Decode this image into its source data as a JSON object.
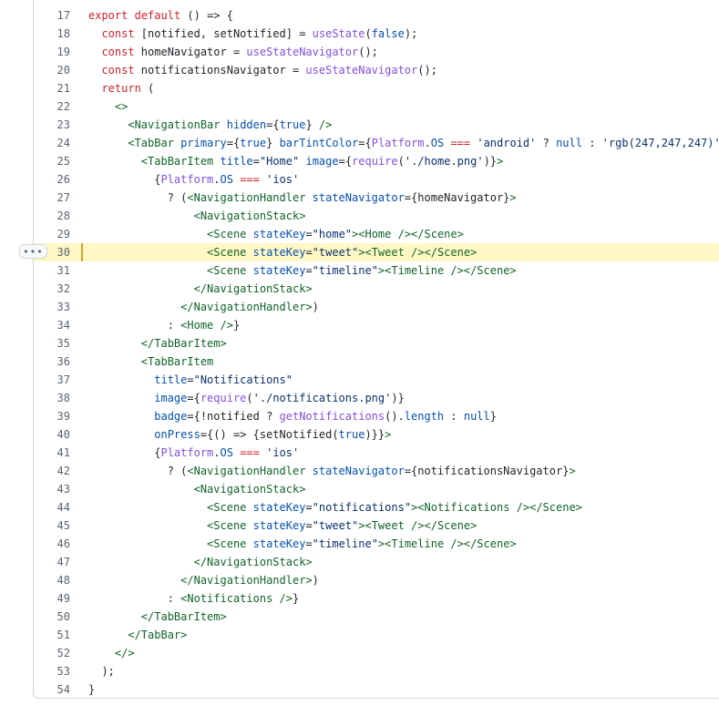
{
  "colors": {
    "kw": "#cf222e",
    "fn": "#8250df",
    "const": "#0550ae",
    "str": "#0a3069",
    "tag": "#116329",
    "plain": "#1f2328"
  },
  "expand_button": {
    "icon": "kebab-horizontal-icon",
    "glyph": "•••"
  },
  "highlighted_line": 30,
  "lines": [
    {
      "n": "17",
      "t": [
        [
          "kw",
          "export"
        ],
        [
          "p",
          " "
        ],
        [
          "kw",
          "default"
        ],
        [
          "p",
          " () => {"
        ]
      ]
    },
    {
      "n": "18",
      "t": [
        [
          "p",
          "  "
        ],
        [
          "kw",
          "const"
        ],
        [
          "p",
          " [notified, setNotified] = "
        ],
        [
          "fn",
          "useState"
        ],
        [
          "p",
          "("
        ],
        [
          "const",
          "false"
        ],
        [
          "p",
          ");"
        ]
      ]
    },
    {
      "n": "19",
      "t": [
        [
          "p",
          "  "
        ],
        [
          "kw",
          "const"
        ],
        [
          "p",
          " homeNavigator = "
        ],
        [
          "fn",
          "useStateNavigator"
        ],
        [
          "p",
          "();"
        ]
      ]
    },
    {
      "n": "20",
      "t": [
        [
          "p",
          "  "
        ],
        [
          "kw",
          "const"
        ],
        [
          "p",
          " notificationsNavigator = "
        ],
        [
          "fn",
          "useStateNavigator"
        ],
        [
          "p",
          "();"
        ]
      ]
    },
    {
      "n": "21",
      "t": [
        [
          "p",
          "  "
        ],
        [
          "kw",
          "return"
        ],
        [
          "p",
          " ("
        ]
      ]
    },
    {
      "n": "22",
      "t": [
        [
          "p",
          "    "
        ],
        [
          "tag",
          "<>"
        ]
      ]
    },
    {
      "n": "23",
      "t": [
        [
          "p",
          "      "
        ],
        [
          "tag",
          "<NavigationBar"
        ],
        [
          "p",
          " "
        ],
        [
          "const",
          "hidden"
        ],
        [
          "p",
          "={"
        ],
        [
          "const",
          "true"
        ],
        [
          "p",
          "} "
        ],
        [
          "tag",
          "/>"
        ]
      ]
    },
    {
      "n": "24",
      "t": [
        [
          "p",
          "      "
        ],
        [
          "tag",
          "<TabBar"
        ],
        [
          "p",
          " "
        ],
        [
          "const",
          "primary"
        ],
        [
          "p",
          "={"
        ],
        [
          "const",
          "true"
        ],
        [
          "p",
          "} "
        ],
        [
          "const",
          "barTintColor"
        ],
        [
          "p",
          "={"
        ],
        [
          "fn",
          "Platform"
        ],
        [
          "p",
          "."
        ],
        [
          "const",
          "OS"
        ],
        [
          "p",
          " "
        ],
        [
          "kw",
          "==="
        ],
        [
          "p",
          " "
        ],
        [
          "str",
          "'android'"
        ],
        [
          "p",
          " ? "
        ],
        [
          "const",
          "null"
        ],
        [
          "p",
          " : "
        ],
        [
          "str",
          "'rgb(247,247,247)'"
        ]
      ]
    },
    {
      "n": "25",
      "t": [
        [
          "p",
          "        "
        ],
        [
          "tag",
          "<TabBarItem"
        ],
        [
          "p",
          " "
        ],
        [
          "const",
          "title"
        ],
        [
          "p",
          "="
        ],
        [
          "str",
          "\"Home\""
        ],
        [
          "p",
          " "
        ],
        [
          "const",
          "image"
        ],
        [
          "p",
          "={"
        ],
        [
          "fn",
          "require"
        ],
        [
          "p",
          "("
        ],
        [
          "str",
          "'./home.png'"
        ],
        [
          "p",
          ")}"
        ],
        [
          "tag",
          ">"
        ]
      ]
    },
    {
      "n": "26",
      "t": [
        [
          "p",
          "          {"
        ],
        [
          "fn",
          "Platform"
        ],
        [
          "p",
          "."
        ],
        [
          "const",
          "OS"
        ],
        [
          "p",
          " "
        ],
        [
          "kw",
          "==="
        ],
        [
          "p",
          " "
        ],
        [
          "str",
          "'ios'"
        ]
      ]
    },
    {
      "n": "27",
      "t": [
        [
          "p",
          "            ? ("
        ],
        [
          "tag",
          "<NavigationHandler"
        ],
        [
          "p",
          " "
        ],
        [
          "const",
          "stateNavigator"
        ],
        [
          "p",
          "={homeNavigator}"
        ],
        [
          "tag",
          ">"
        ]
      ]
    },
    {
      "n": "28",
      "t": [
        [
          "p",
          "                "
        ],
        [
          "tag",
          "<NavigationStack>"
        ]
      ]
    },
    {
      "n": "29",
      "t": [
        [
          "p",
          "                  "
        ],
        [
          "tag",
          "<Scene"
        ],
        [
          "p",
          " "
        ],
        [
          "const",
          "stateKey"
        ],
        [
          "p",
          "="
        ],
        [
          "str",
          "\"home\""
        ],
        [
          "tag",
          "><Home /></Scene>"
        ]
      ]
    },
    {
      "n": "30",
      "t": [
        [
          "p",
          "                  "
        ],
        [
          "tag",
          "<Scene"
        ],
        [
          "p",
          " "
        ],
        [
          "const",
          "stateKey"
        ],
        [
          "p",
          "="
        ],
        [
          "str",
          "\"tweet\""
        ],
        [
          "tag",
          "><Tweet /></Scene>"
        ]
      ]
    },
    {
      "n": "31",
      "t": [
        [
          "p",
          "                  "
        ],
        [
          "tag",
          "<Scene"
        ],
        [
          "p",
          " "
        ],
        [
          "const",
          "stateKey"
        ],
        [
          "p",
          "="
        ],
        [
          "str",
          "\"timeline\""
        ],
        [
          "tag",
          "><Timeline /></Scene>"
        ]
      ]
    },
    {
      "n": "32",
      "t": [
        [
          "p",
          "                "
        ],
        [
          "tag",
          "</NavigationStack>"
        ]
      ]
    },
    {
      "n": "33",
      "t": [
        [
          "p",
          "              "
        ],
        [
          "tag",
          "</NavigationHandler>"
        ],
        [
          "p",
          ")"
        ]
      ]
    },
    {
      "n": "34",
      "t": [
        [
          "p",
          "            : "
        ],
        [
          "tag",
          "<Home />"
        ],
        [
          "p",
          "}"
        ]
      ]
    },
    {
      "n": "35",
      "t": [
        [
          "p",
          "        "
        ],
        [
          "tag",
          "</TabBarItem>"
        ]
      ]
    },
    {
      "n": "36",
      "t": [
        [
          "p",
          "        "
        ],
        [
          "tag",
          "<TabBarItem"
        ]
      ]
    },
    {
      "n": "37",
      "t": [
        [
          "p",
          "          "
        ],
        [
          "const",
          "title"
        ],
        [
          "p",
          "="
        ],
        [
          "str",
          "\"Notifications\""
        ]
      ]
    },
    {
      "n": "38",
      "t": [
        [
          "p",
          "          "
        ],
        [
          "const",
          "image"
        ],
        [
          "p",
          "={"
        ],
        [
          "fn",
          "require"
        ],
        [
          "p",
          "("
        ],
        [
          "str",
          "'./notifications.png'"
        ],
        [
          "p",
          ")}"
        ]
      ]
    },
    {
      "n": "39",
      "t": [
        [
          "p",
          "          "
        ],
        [
          "const",
          "badge"
        ],
        [
          "p",
          "={!notified ? "
        ],
        [
          "fn",
          "getNotifications"
        ],
        [
          "p",
          "()."
        ],
        [
          "const",
          "length"
        ],
        [
          "p",
          " : "
        ],
        [
          "const",
          "null"
        ],
        [
          "p",
          "}"
        ]
      ]
    },
    {
      "n": "40",
      "t": [
        [
          "p",
          "          "
        ],
        [
          "const",
          "onPress"
        ],
        [
          "p",
          "={() => {setNotified("
        ],
        [
          "const",
          "true"
        ],
        [
          "p",
          ")}}"
        ],
        [
          "tag",
          ">"
        ]
      ]
    },
    {
      "n": "41",
      "t": [
        [
          "p",
          "          {"
        ],
        [
          "fn",
          "Platform"
        ],
        [
          "p",
          "."
        ],
        [
          "const",
          "OS"
        ],
        [
          "p",
          " "
        ],
        [
          "kw",
          "==="
        ],
        [
          "p",
          " "
        ],
        [
          "str",
          "'ios'"
        ]
      ]
    },
    {
      "n": "42",
      "t": [
        [
          "p",
          "            ? ("
        ],
        [
          "tag",
          "<NavigationHandler"
        ],
        [
          "p",
          " "
        ],
        [
          "const",
          "stateNavigator"
        ],
        [
          "p",
          "={notificationsNavigator}"
        ],
        [
          "tag",
          ">"
        ]
      ]
    },
    {
      "n": "43",
      "t": [
        [
          "p",
          "                "
        ],
        [
          "tag",
          "<NavigationStack>"
        ]
      ]
    },
    {
      "n": "44",
      "t": [
        [
          "p",
          "                  "
        ],
        [
          "tag",
          "<Scene"
        ],
        [
          "p",
          " "
        ],
        [
          "const",
          "stateKey"
        ],
        [
          "p",
          "="
        ],
        [
          "str",
          "\"notifications\""
        ],
        [
          "tag",
          "><Notifications /></Scene>"
        ]
      ]
    },
    {
      "n": "45",
      "t": [
        [
          "p",
          "                  "
        ],
        [
          "tag",
          "<Scene"
        ],
        [
          "p",
          " "
        ],
        [
          "const",
          "stateKey"
        ],
        [
          "p",
          "="
        ],
        [
          "str",
          "\"tweet\""
        ],
        [
          "tag",
          "><Tweet /></Scene>"
        ]
      ]
    },
    {
      "n": "46",
      "t": [
        [
          "p",
          "                  "
        ],
        [
          "tag",
          "<Scene"
        ],
        [
          "p",
          " "
        ],
        [
          "const",
          "stateKey"
        ],
        [
          "p",
          "="
        ],
        [
          "str",
          "\"timeline\""
        ],
        [
          "tag",
          "><Timeline /></Scene>"
        ]
      ]
    },
    {
      "n": "47",
      "t": [
        [
          "p",
          "                "
        ],
        [
          "tag",
          "</NavigationStack>"
        ]
      ]
    },
    {
      "n": "48",
      "t": [
        [
          "p",
          "              "
        ],
        [
          "tag",
          "</NavigationHandler>"
        ],
        [
          "p",
          ")"
        ]
      ]
    },
    {
      "n": "49",
      "t": [
        [
          "p",
          "            : "
        ],
        [
          "tag",
          "<Notifications />"
        ],
        [
          "p",
          "}"
        ]
      ]
    },
    {
      "n": "50",
      "t": [
        [
          "p",
          "        "
        ],
        [
          "tag",
          "</TabBarItem>"
        ]
      ]
    },
    {
      "n": "51",
      "t": [
        [
          "p",
          "      "
        ],
        [
          "tag",
          "</TabBar>"
        ]
      ]
    },
    {
      "n": "52",
      "t": [
        [
          "p",
          "    "
        ],
        [
          "tag",
          "</>"
        ]
      ]
    },
    {
      "n": "53",
      "t": [
        [
          "p",
          "  );"
        ]
      ]
    },
    {
      "n": "54",
      "t": [
        [
          "p",
          "}"
        ]
      ]
    }
  ]
}
